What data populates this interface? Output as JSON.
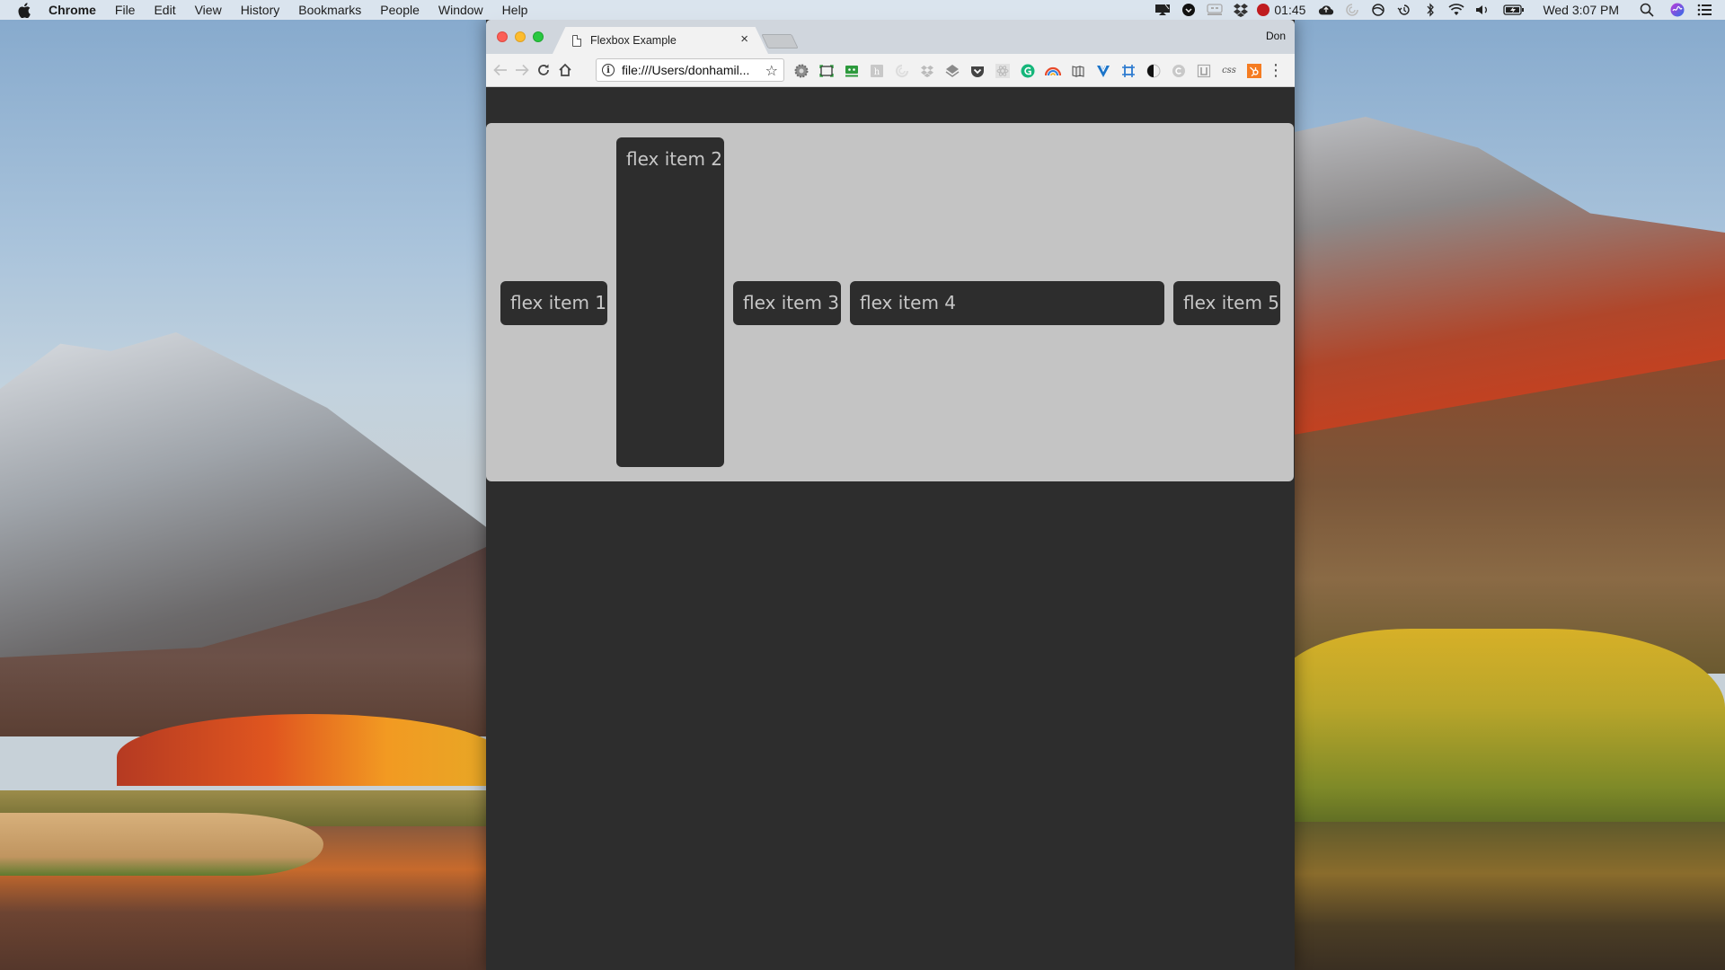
{
  "menubar": {
    "app_name": "Chrome",
    "items": [
      "File",
      "Edit",
      "View",
      "History",
      "Bookmarks",
      "People",
      "Window",
      "Help"
    ],
    "status_icons": [
      "airplay-icon",
      "shield-icon",
      "keyboard-icon",
      "dropbox-icon",
      "record-icon",
      "cloud-upload-icon",
      "spinner-icon",
      "sync-icon",
      "time-machine-icon",
      "bluetooth-icon",
      "wifi-icon",
      "volume-icon",
      "battery-icon",
      "search-icon",
      "siri-icon",
      "notification-center-icon"
    ],
    "recording_time": "01:45",
    "clock": "Wed 3:07 PM"
  },
  "browser": {
    "tab_title": "Flexbox Example",
    "profile_name": "Don",
    "url": "file:///Users/donhamil...",
    "extensions": [
      "settings-gear-icon",
      "screenshot-icon",
      "rememberthemilk-icon",
      "hypothesis-icon",
      "vpn-icon",
      "dropbox-icon",
      "layers-icon",
      "pocket-icon",
      "react-icon",
      "grammarly-icon",
      "arc-icon",
      "reader-icon",
      "vue-icon",
      "grid-icon",
      "contrast-icon",
      "copy-icon",
      "ublock-icon",
      "css-icon",
      "hubspot-icon"
    ],
    "css_ext_label": "css"
  },
  "page": {
    "flex_items": [
      "flex item 1",
      "flex item 2",
      "flex item 3",
      "flex item 4",
      "flex item 5"
    ]
  },
  "colors": {
    "page_bg": "#2d2d2d",
    "container_bg": "#c4c4c4",
    "item_bg": "#2d2d2d",
    "item_text": "#c7c7c7"
  }
}
